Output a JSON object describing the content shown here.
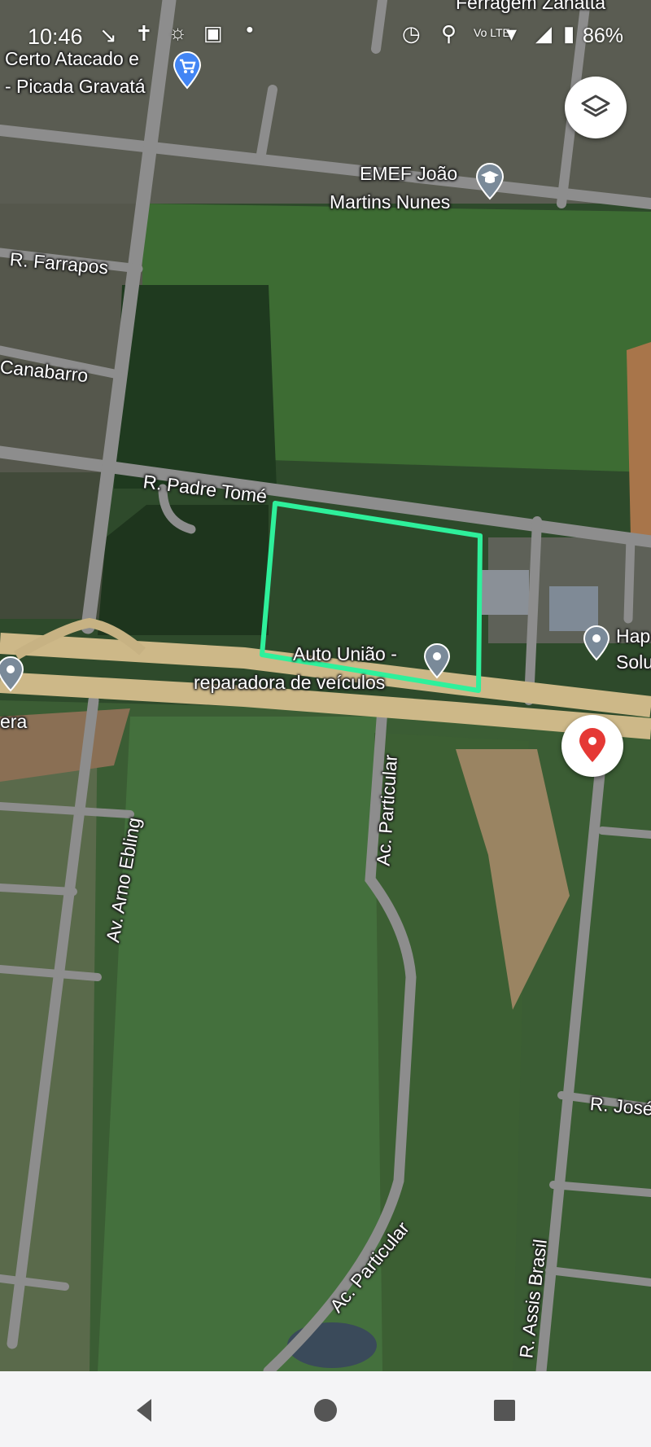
{
  "status_bar": {
    "time": "10:46",
    "battery": "86%",
    "icons": [
      "missed-call-icon",
      "cross-icon",
      "messenger-icon",
      "instagram-icon",
      "dot-icon",
      "alarm-icon",
      "location-icon",
      "volte-icon",
      "wifi-icon",
      "signal-icon",
      "battery-icon"
    ]
  },
  "map": {
    "view": "satellite",
    "highlight_color": "#2ef09b",
    "accent_marker_color": "#e53935",
    "place_labels": {
      "top_business": "Ferragem Zanatta",
      "certo_line1": "Certo Atacado e",
      "certo_line2": "- Picada Gravatá",
      "school_line1": "EMEF João",
      "school_line2": "Martins Nunes",
      "auto_line1": "Auto União -",
      "auto_line2": "reparadora de veículos",
      "hap_line1": "Hap",
      "hap_line2": "Solu",
      "left_business": "era"
    },
    "street_labels": {
      "farrapos": "R. Farrapos",
      "canabarro": "Canabarro",
      "padre_tome": "R. Padre Tomé",
      "arno_ebling": "Av. Arno Ebling",
      "particular_north": "Ac. Particular",
      "particular_south": "Ac. Particular",
      "jose": "R. José",
      "assis_brasil": "R. Assis Brasil"
    }
  },
  "navbar": {
    "buttons": [
      "back-icon",
      "home-icon",
      "recents-icon"
    ]
  }
}
